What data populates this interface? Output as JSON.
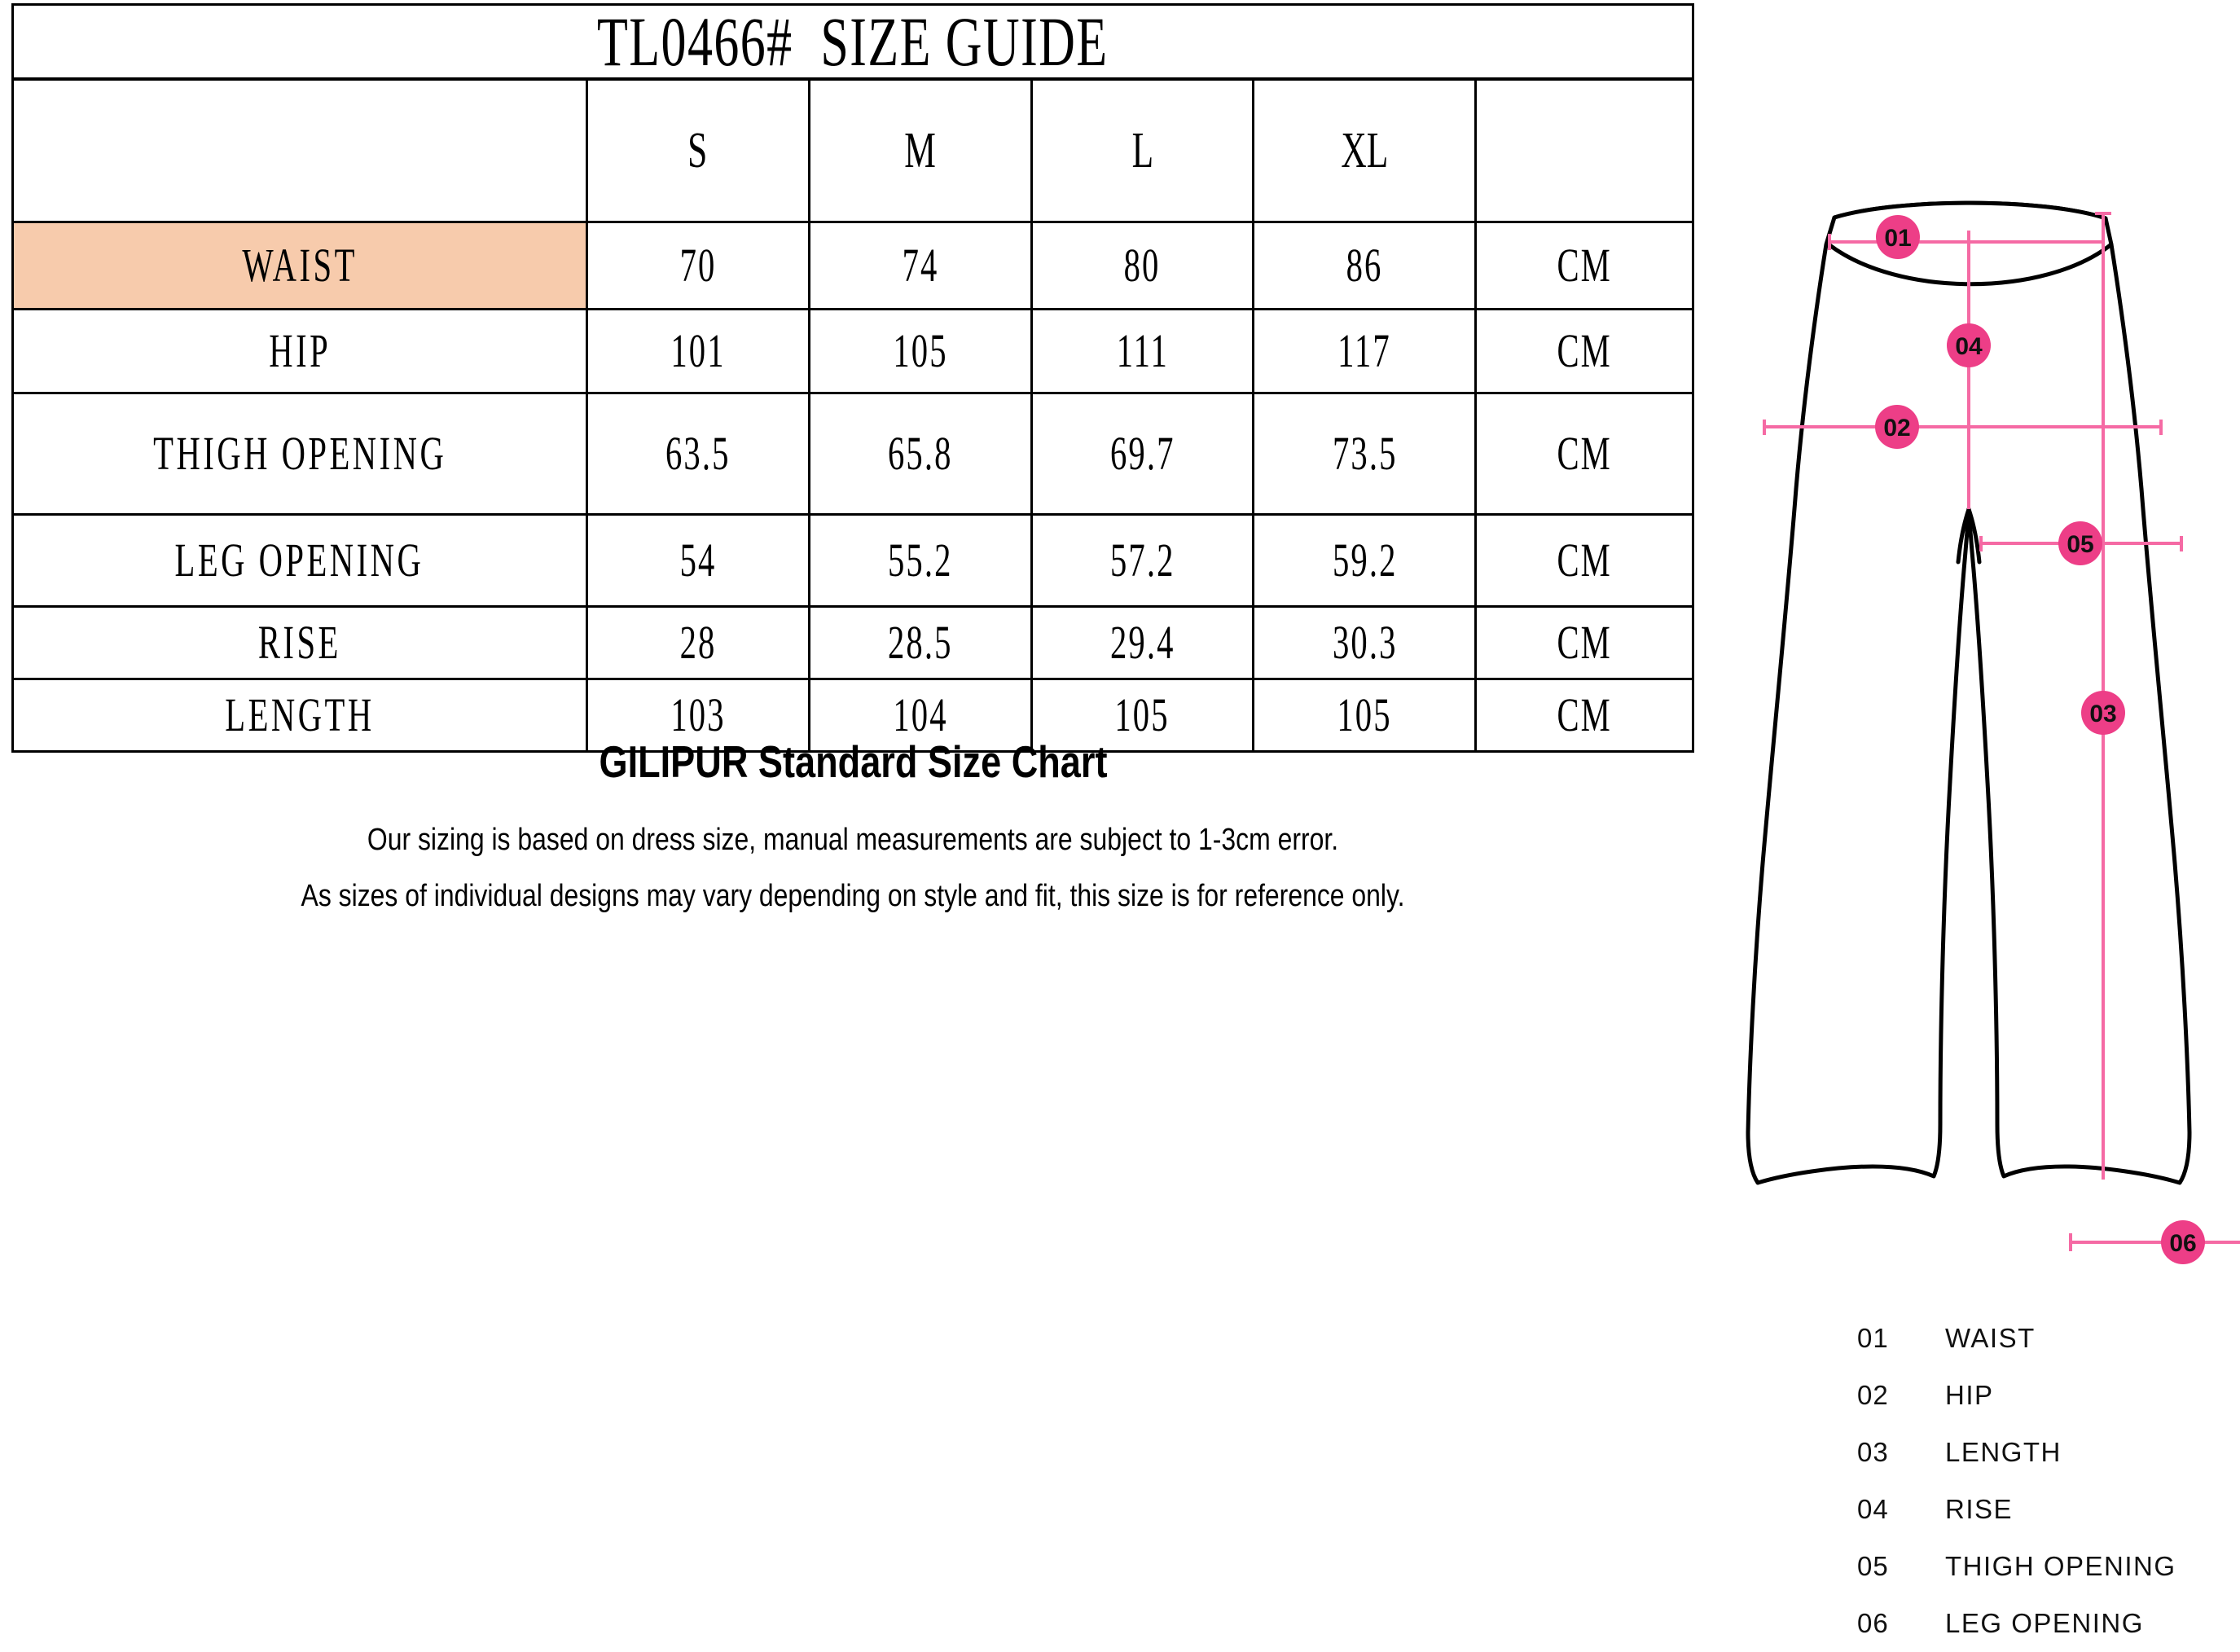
{
  "title": "TL0466#  SIZE GUIDE",
  "table": {
    "columns": [
      "",
      "S",
      "M",
      "L",
      "XL",
      ""
    ],
    "rows": [
      {
        "label": "WAIST",
        "values": [
          "70",
          "74",
          "80",
          "86"
        ],
        "unit": "CM",
        "highlight": true
      },
      {
        "label": "HIP",
        "values": [
          "101",
          "105",
          "111",
          "117"
        ],
        "unit": "CM",
        "highlight": false
      },
      {
        "label": "THIGH OPENING",
        "values": [
          "63.5",
          "65.8",
          "69.7",
          "73.5"
        ],
        "unit": "CM",
        "highlight": false
      },
      {
        "label": "LEG OPENING",
        "values": [
          "54",
          "55.2",
          "57.2",
          "59.2"
        ],
        "unit": "CM",
        "highlight": false
      },
      {
        "label": "RISE",
        "values": [
          "28",
          "28.5",
          "29.4",
          "30.3"
        ],
        "unit": "CM",
        "highlight": false
      },
      {
        "label": "LENGTH",
        "values": [
          "103",
          "104",
          "105",
          "105"
        ],
        "unit": "CM",
        "highlight": false
      }
    ]
  },
  "footer": {
    "heading": "GILIPUR Standard Size Chart",
    "line1": "Our sizing is based on dress size, manual measurements are subject to 1-3cm error.",
    "line2": "As sizes of individual designs may vary depending on style and fit, this size is for reference only."
  },
  "legend": {
    "items": [
      {
        "num": "01",
        "label": "WAIST"
      },
      {
        "num": "02",
        "label": "HIP"
      },
      {
        "num": "03",
        "label": "LENGTH"
      },
      {
        "num": "04",
        "label": "RISE"
      },
      {
        "num": "05",
        "label": "THIGH OPENING"
      },
      {
        "num": "06",
        "label": "LEG OPENING"
      }
    ]
  },
  "illustration": {
    "markers": [
      {
        "id": "01",
        "measure": "WAIST"
      },
      {
        "id": "02",
        "measure": "HIP"
      },
      {
        "id": "03",
        "measure": "LENGTH"
      },
      {
        "id": "04",
        "measure": "RISE"
      },
      {
        "id": "05",
        "measure": "THIGH OPENING"
      },
      {
        "id": "06",
        "measure": "LEG OPENING"
      }
    ]
  },
  "colors": {
    "highlight": "#F7CBAC",
    "marker_pink": "#ED3E87",
    "guide_line": "#F56AA4",
    "outline": "#000000"
  },
  "chart_data": {
    "type": "table",
    "title": "TL0466#  SIZE GUIDE",
    "categories": [
      "S",
      "M",
      "L",
      "XL"
    ],
    "unit": "CM",
    "series": [
      {
        "name": "WAIST",
        "values": [
          70,
          74,
          80,
          86
        ]
      },
      {
        "name": "HIP",
        "values": [
          101,
          105,
          111,
          117
        ]
      },
      {
        "name": "THIGH OPENING",
        "values": [
          63.5,
          65.8,
          69.7,
          73.5
        ]
      },
      {
        "name": "LEG OPENING",
        "values": [
          54,
          55.2,
          57.2,
          59.2
        ]
      },
      {
        "name": "RISE",
        "values": [
          28,
          28.5,
          29.4,
          30.3
        ]
      },
      {
        "name": "LENGTH",
        "values": [
          103,
          104,
          105,
          105
        ]
      }
    ]
  }
}
